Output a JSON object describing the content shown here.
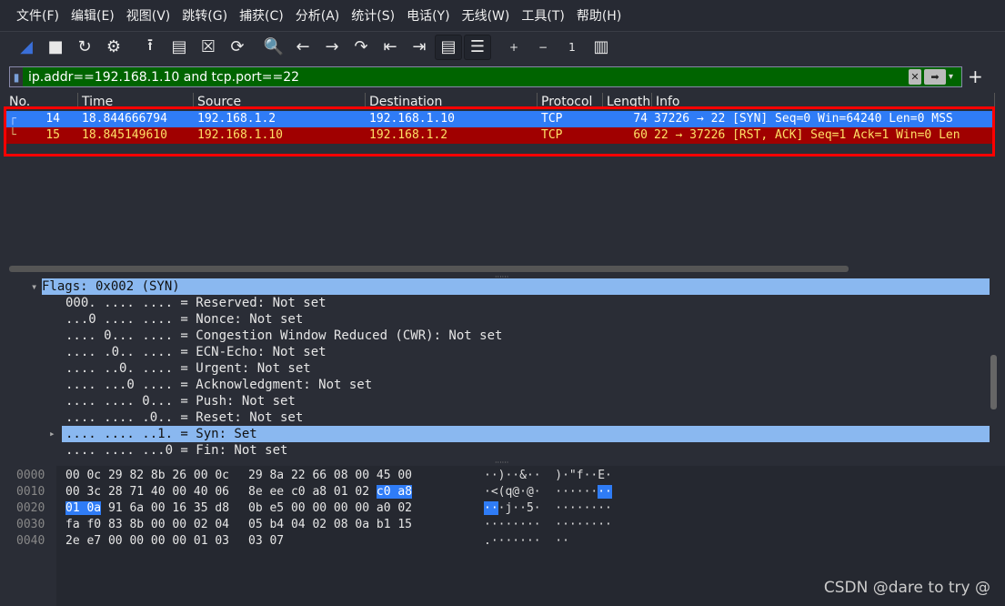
{
  "menu": [
    "文件(F)",
    "编辑(E)",
    "视图(V)",
    "跳转(G)",
    "捕获(C)",
    "分析(A)",
    "统计(S)",
    "电话(Y)",
    "无线(W)",
    "工具(T)",
    "帮助(H)"
  ],
  "toolbar": [
    {
      "icon": "shark-fin-start-icon",
      "glyph": "◢"
    },
    {
      "icon": "stop-icon",
      "glyph": "■"
    },
    {
      "icon": "restart-icon",
      "glyph": "↻"
    },
    {
      "icon": "gear-options-icon",
      "glyph": "⚙"
    },
    {
      "icon": "open-upload-icon",
      "glyph": "⭱"
    },
    {
      "icon": "file-icon",
      "glyph": "▤"
    },
    {
      "icon": "close-file-icon",
      "glyph": "☒"
    },
    {
      "icon": "reload-icon",
      "glyph": "⟳"
    },
    {
      "icon": "search-icon",
      "glyph": "🔍"
    },
    {
      "icon": "back-arrow-icon",
      "glyph": "←"
    },
    {
      "icon": "forward-arrow-icon",
      "glyph": "→"
    },
    {
      "icon": "goto-packet-icon",
      "glyph": "↷"
    },
    {
      "icon": "first-packet-icon",
      "glyph": "⇤"
    },
    {
      "icon": "last-packet-icon",
      "glyph": "⇥"
    },
    {
      "icon": "autoscroll-icon",
      "glyph": "▤"
    },
    {
      "icon": "colorize-icon",
      "glyph": "☰"
    },
    {
      "icon": "zoom-in-icon",
      "glyph": "+"
    },
    {
      "icon": "zoom-out-icon",
      "glyph": "−"
    },
    {
      "icon": "normal-size-icon",
      "glyph": "1"
    },
    {
      "icon": "resize-columns-icon",
      "glyph": "▥"
    }
  ],
  "filter": {
    "value": "ip.addr==192.168.1.10 and tcp.port==22",
    "bg_color": "#006400"
  },
  "columns": [
    "No.",
    "Time",
    "Source",
    "Destination",
    "Protocol",
    "Length",
    "Info"
  ],
  "packets": [
    {
      "no": "14",
      "time": "18.844666794",
      "src": "192.168.1.2",
      "dst": "192.168.1.10",
      "proto": "TCP",
      "len": "74",
      "info": "37226 → 22 [SYN] Seq=0 Win=64240 Len=0 MSS",
      "bg": "#2f7cf6",
      "fg": "#ffffff"
    },
    {
      "no": "15",
      "time": "18.845149610",
      "src": "192.168.1.10",
      "dst": "192.168.1.2",
      "proto": "TCP",
      "len": "60",
      "info": "22 → 37226 [RST, ACK] Seq=1 Ack=1 Win=0 Len",
      "bg": "#a00000",
      "fg": "#ffe066"
    }
  ],
  "details": [
    {
      "text": "▾ Flags: 0x002 (SYN)",
      "indent": 1,
      "sel": true
    },
    {
      "text": "000. .... .... = Reserved: Not set",
      "indent": 3
    },
    {
      "text": "...0 .... .... = Nonce: Not set",
      "indent": 3
    },
    {
      "text": ".... 0... .... = Congestion Window Reduced (CWR): Not set",
      "indent": 3
    },
    {
      "text": ".... .0.. .... = ECN-Echo: Not set",
      "indent": 3
    },
    {
      "text": ".... ..0. .... = Urgent: Not set",
      "indent": 3
    },
    {
      "text": ".... ...0 .... = Acknowledgment: Not set",
      "indent": 3
    },
    {
      "text": ".... .... 0... = Push: Not set",
      "indent": 3
    },
    {
      "text": ".... .... .0.. = Reset: Not set",
      "indent": 3
    },
    {
      "text": ".... .... ..1. = Syn: Set",
      "indent": 3,
      "sel": true,
      "arrow": "▸"
    },
    {
      "text": ".... .... ...0 = Fin: Not set",
      "indent": 3
    }
  ],
  "hex": [
    {
      "off": "0000",
      "a": "00 0c 29 82 8b 26 00 0c",
      "b": "29 8a 22 66 08 00 45 00",
      "asc": "··)··&··  )·\"f··E·"
    },
    {
      "off": "0010",
      "a": "00 3c 28 71 40 00 40 06",
      "b": "8e ee c0 a8 01 02 c0 a8",
      "asc": "·<(q@·@·  ······",
      "ascHi": "··"
    },
    {
      "off": "0020",
      "a": "01 0a 91 6a 00 16 35 d8",
      "b": "0b e5 00 00 00 00 a0 02",
      "asc": "·j··5·  ········",
      "ascHiPre": "··"
    },
    {
      "off": "0030",
      "a": "fa f0 83 8b 00 00 02 04",
      "b": "05 b4 04 02 08 0a b1 15",
      "asc": "········  ········"
    },
    {
      "off": "0040",
      "a": "2e e7 00 00 00 00 01 03",
      "b": "03 07",
      "asc": ".·······  ··"
    }
  ],
  "watermark": "CSDN @dare to try @"
}
